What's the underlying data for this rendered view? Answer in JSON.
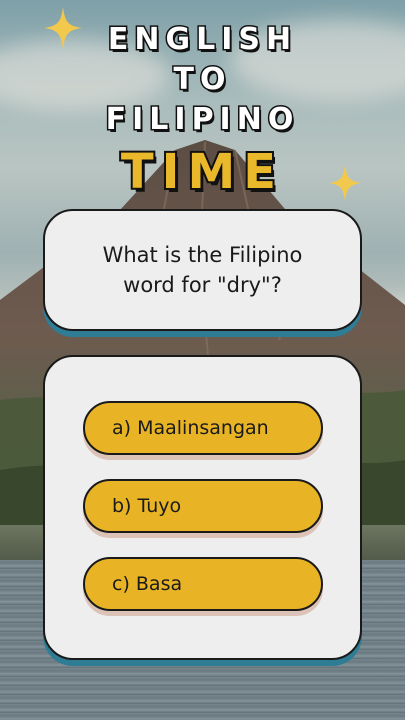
{
  "title": {
    "line1": "ENGLISH",
    "line2": "TO",
    "line3": "FILIPINO",
    "line4": "TIME"
  },
  "question": {
    "text": "What is the Filipino\nword for \"dry\"?"
  },
  "options": [
    {
      "label": "a) Maalinsangan"
    },
    {
      "label": "b) Tuyo"
    },
    {
      "label": "c) Basa"
    }
  ],
  "colors": {
    "card_bg": "#eeeeee",
    "card_shadow": "#2f7c95",
    "option_fill": "#e8b426",
    "accent_title": "#eab92b",
    "sparkle": "#f2c94c"
  },
  "icons": [
    "sparkle-icon"
  ]
}
